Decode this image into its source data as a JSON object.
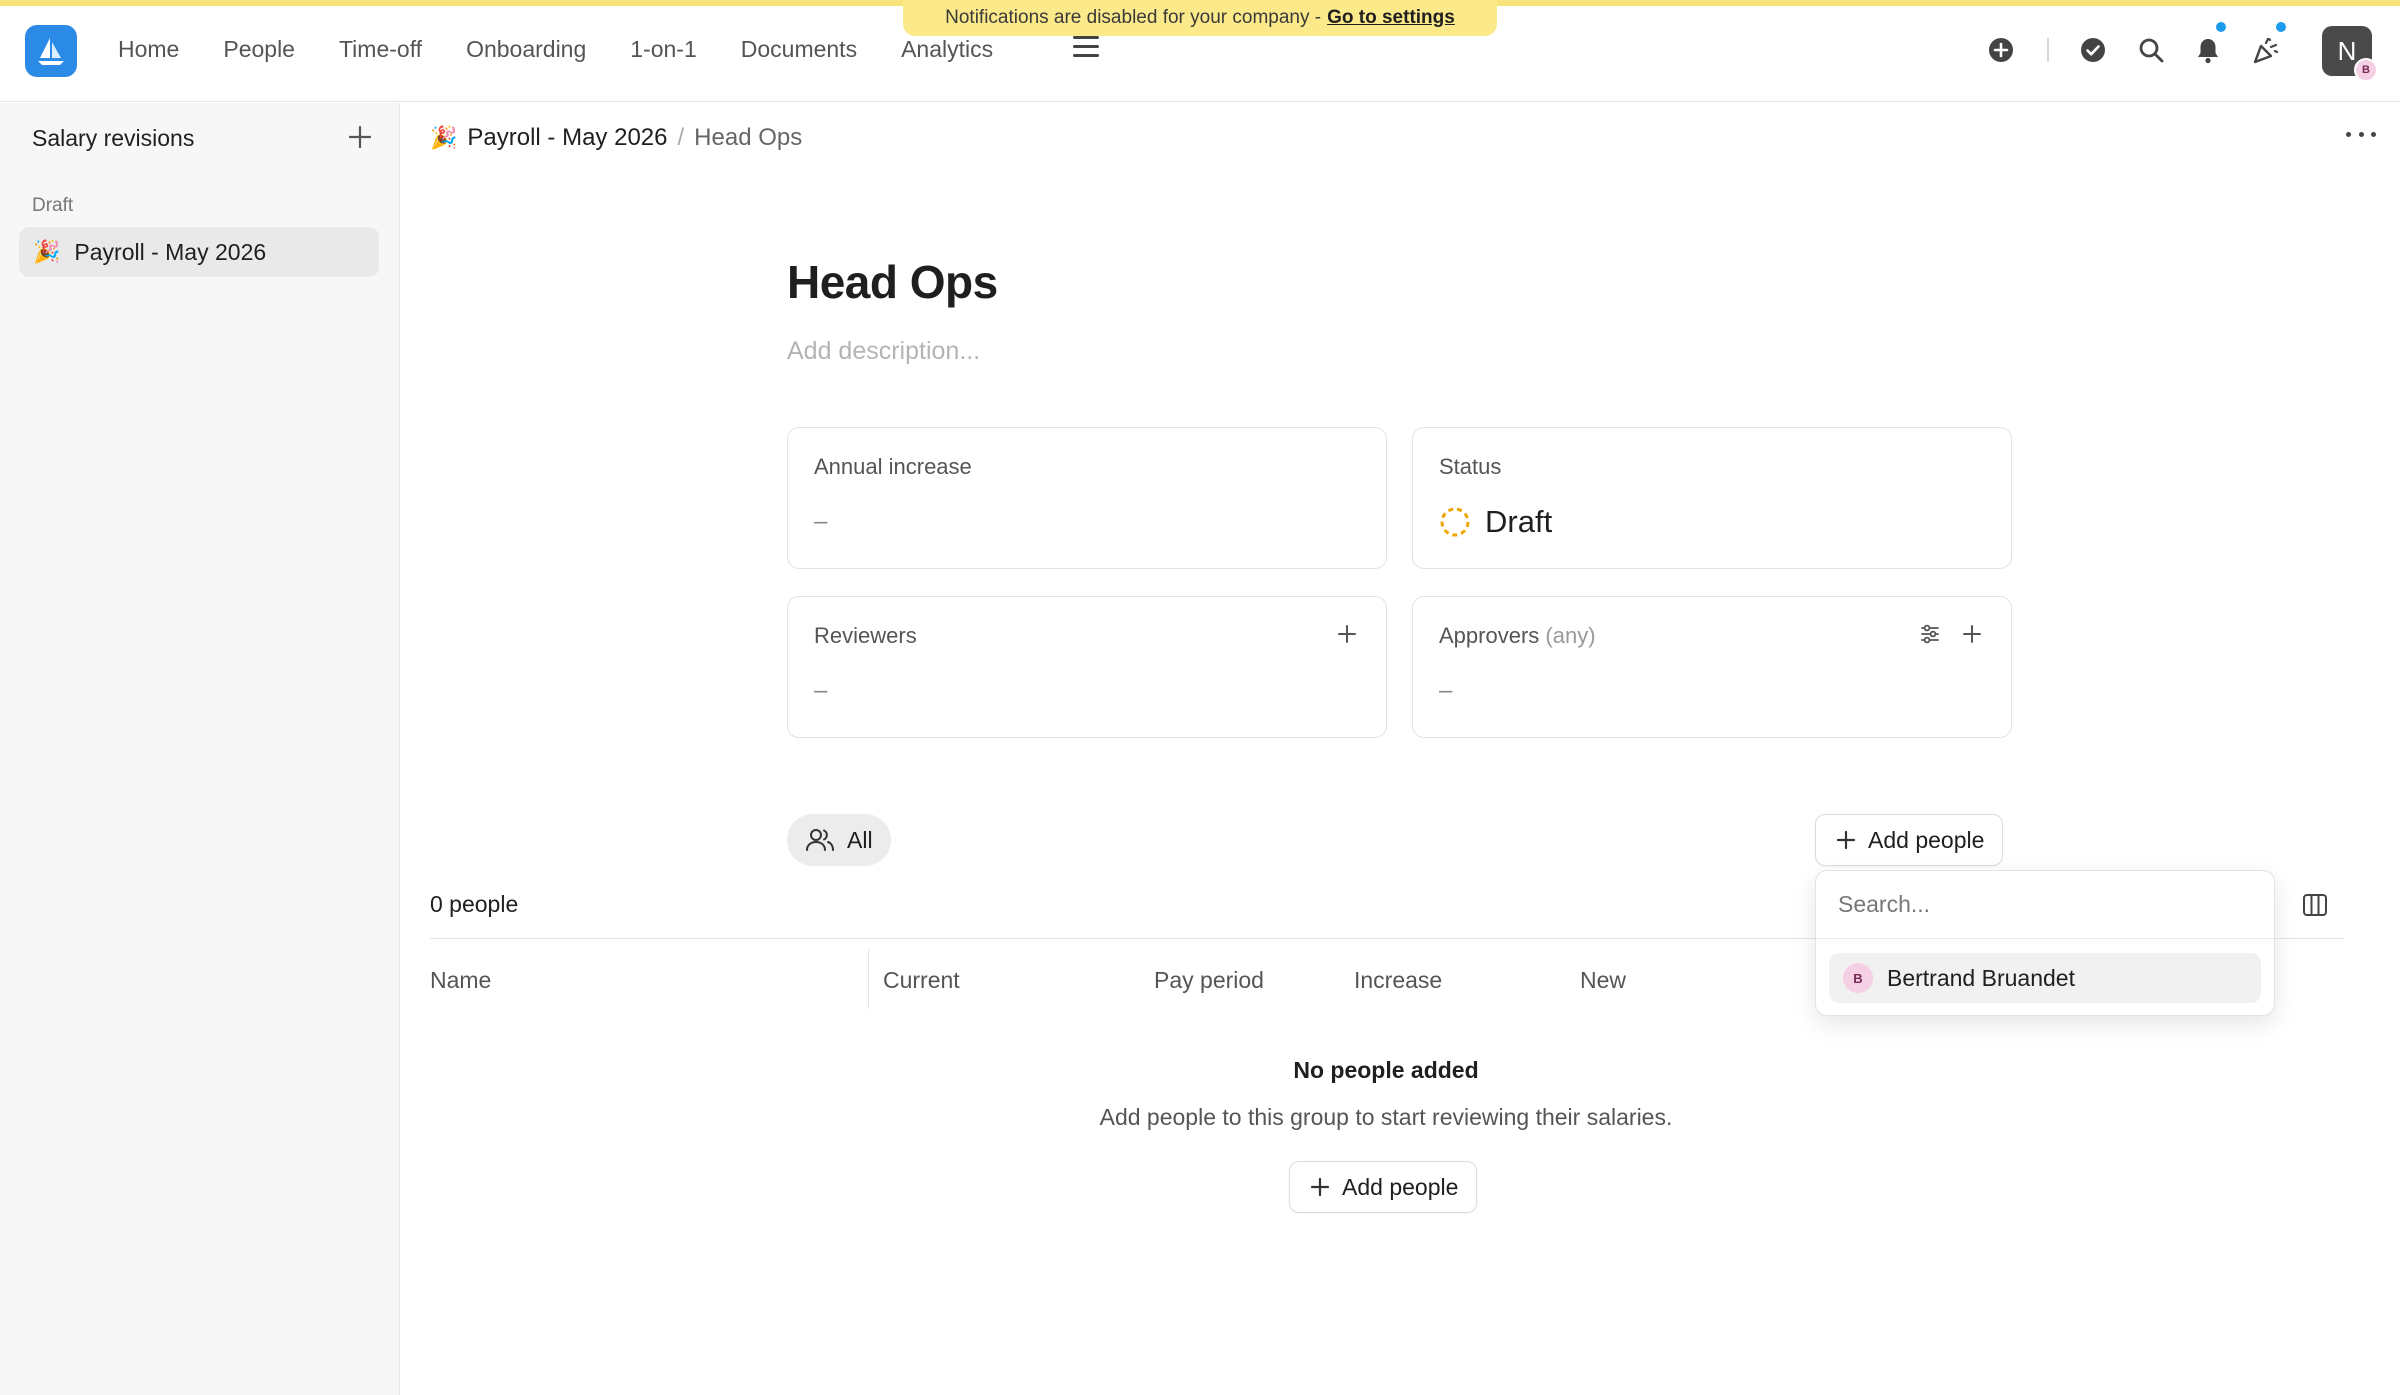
{
  "notice": {
    "text": "Notifications are disabled for your company -",
    "link": "Go to settings"
  },
  "nav": {
    "items": [
      "Home",
      "People",
      "Time-off",
      "Onboarding",
      "1-on-1",
      "Documents",
      "Analytics"
    ]
  },
  "user": {
    "avatar_initial": "N",
    "badge_initial": "B"
  },
  "sidebar": {
    "title": "Salary revisions",
    "section": "Draft",
    "items": [
      {
        "emoji": "🎉",
        "label": "Payroll - May 2026"
      }
    ]
  },
  "breadcrumb": {
    "parent_emoji": "🎉",
    "parent": "Payroll - May 2026",
    "separator": "/",
    "current": "Head Ops"
  },
  "page": {
    "title": "Head Ops",
    "description_placeholder": "Add description..."
  },
  "cards": {
    "annual_increase": {
      "label": "Annual increase",
      "value": "–"
    },
    "status": {
      "label": "Status",
      "value": "Draft"
    },
    "reviewers": {
      "label": "Reviewers",
      "value": "–"
    },
    "approvers": {
      "label": "Approvers",
      "qualifier": "(any)",
      "value": "–"
    }
  },
  "filter": {
    "label": "All"
  },
  "actions": {
    "add_people": "Add people"
  },
  "table": {
    "count": "0 people",
    "columns": [
      "Name",
      "Current",
      "Pay period",
      "Increase",
      "New"
    ],
    "empty_title": "No people added",
    "empty_subtitle": "Add people to this group to start reviewing their salaries."
  },
  "dropdown": {
    "search_placeholder": "Search...",
    "options": [
      {
        "initial": "B",
        "name": "Bertrand Bruandet"
      }
    ]
  },
  "colors": {
    "accent": "#2b8ae6",
    "notification_dot": "#1b9aee",
    "notice_bg": "#fbe98a",
    "draft_status": "#f0a500"
  }
}
